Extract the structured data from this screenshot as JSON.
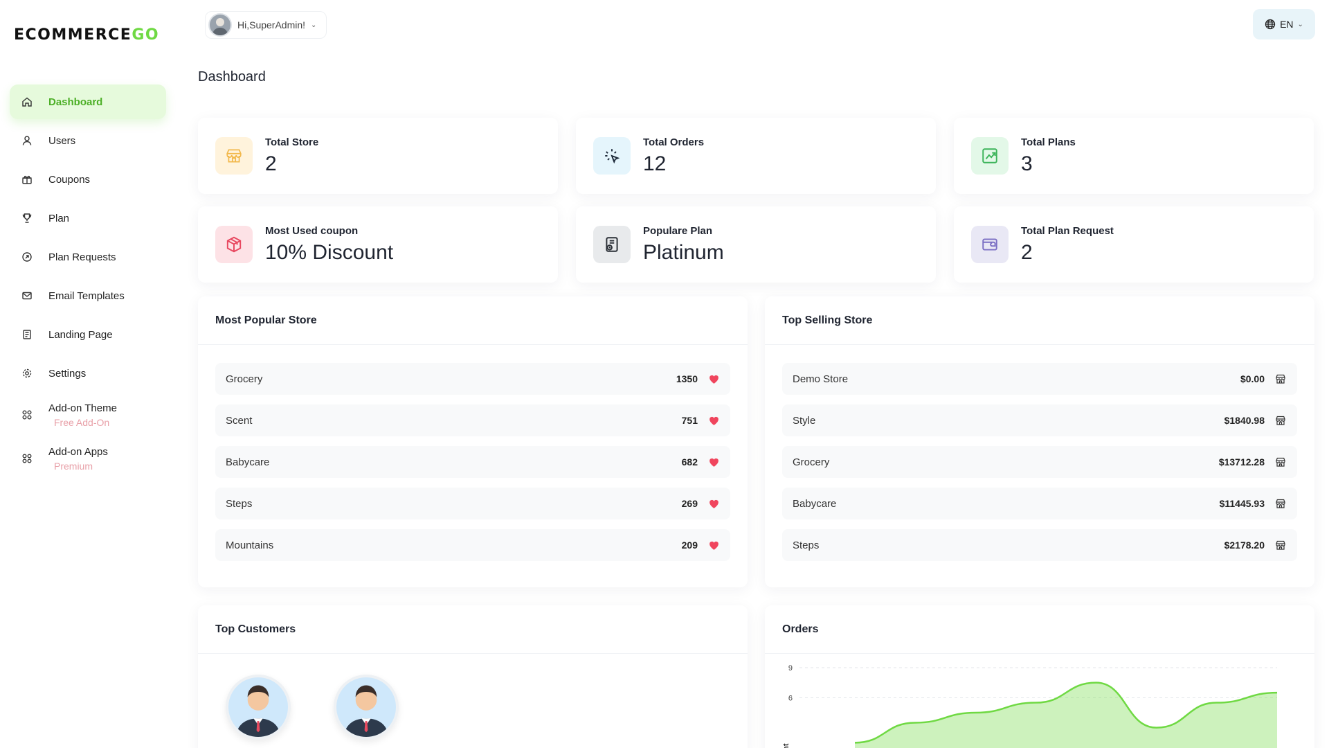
{
  "brand": {
    "logo_main": "ECOMMERCE",
    "logo_accent": "GO"
  },
  "header": {
    "greeting": "Hi,SuperAdmin!",
    "language": "EN"
  },
  "page_title": "Dashboard",
  "sidebar": {
    "items": [
      {
        "label": "Dashboard",
        "icon": "home-icon",
        "active": true
      },
      {
        "label": "Users",
        "icon": "user-icon"
      },
      {
        "label": "Coupons",
        "icon": "gift-icon"
      },
      {
        "label": "Plan",
        "icon": "trophy-icon"
      },
      {
        "label": "Plan Requests",
        "icon": "request-icon"
      },
      {
        "label": "Email Templates",
        "icon": "mail-icon"
      },
      {
        "label": "Landing Page",
        "icon": "page-icon"
      },
      {
        "label": "Settings",
        "icon": "gear-icon"
      },
      {
        "label": "Add-on Theme",
        "sub": "Free Add-On",
        "icon": "grid-icon"
      },
      {
        "label": "Add-on Apps",
        "sub": "Premium",
        "icon": "grid-icon"
      }
    ]
  },
  "stats": [
    {
      "label": "Total Store",
      "value": "2",
      "icon": "store-icon",
      "bg": "#fff3dc",
      "color": "#f2b84b"
    },
    {
      "label": "Total Orders",
      "value": "12",
      "icon": "click-icon",
      "bg": "#e5f5fc",
      "color": "#1e2a3a"
    },
    {
      "label": "Total Plans",
      "value": "3",
      "icon": "chart-icon",
      "bg": "#e3f8e8",
      "color": "#3cb45a"
    },
    {
      "label": "Most Used coupon",
      "value": "10% Discount",
      "icon": "box-icon",
      "bg": "#fde2e6",
      "color": "#e8475f"
    },
    {
      "label": "Populare Plan",
      "value": "Platinum",
      "icon": "plan-icon",
      "bg": "#e8eaec",
      "color": "#2a2f36"
    },
    {
      "label": "Total Plan Request",
      "value": "2",
      "icon": "wallet-icon",
      "bg": "#e9e8f5",
      "color": "#7b6fc4"
    }
  ],
  "popular_store": {
    "title": "Most Popular Store",
    "rows": [
      {
        "name": "Grocery",
        "value": "1350"
      },
      {
        "name": "Scent",
        "value": "751"
      },
      {
        "name": "Babycare",
        "value": "682"
      },
      {
        "name": "Steps",
        "value": "269"
      },
      {
        "name": "Mountains",
        "value": "209"
      }
    ]
  },
  "top_selling": {
    "title": "Top Selling Store",
    "rows": [
      {
        "name": "Demo Store",
        "value": "$0.00"
      },
      {
        "name": "Style",
        "value": "$1840.98"
      },
      {
        "name": "Grocery",
        "value": "$13712.28"
      },
      {
        "name": "Babycare",
        "value": "$11445.93"
      },
      {
        "name": "Steps",
        "value": "$2178.20"
      }
    ]
  },
  "top_customers": {
    "title": "Top Customers",
    "count": 2
  },
  "orders": {
    "title": "Orders",
    "chart_data": {
      "type": "area",
      "yticks": [
        "9",
        "6"
      ],
      "ylim": [
        0,
        9
      ],
      "ylabel": "nount",
      "values": [
        1.5,
        3.5,
        4.5,
        5.5,
        7.5,
        3.0,
        5.5,
        6.5
      ],
      "color": "#6fd943"
    }
  },
  "colors": {
    "accent": "#6fd943",
    "heart": "#f0455d"
  }
}
